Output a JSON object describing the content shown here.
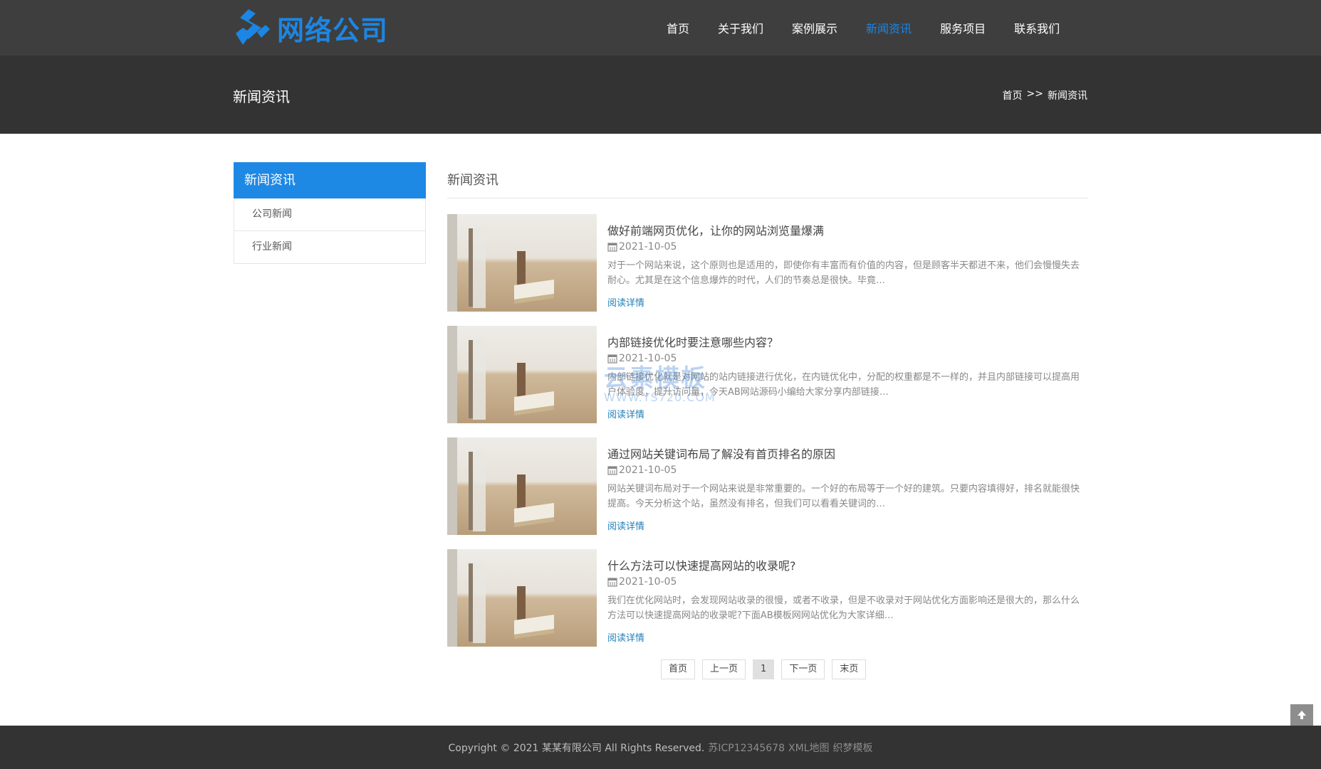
{
  "header": {
    "logo_text": "网络公司",
    "brand_color": "#1c86e4",
    "nav": [
      "首页",
      "关于我们",
      "案例展示",
      "新闻资讯",
      "服务项目",
      "联系我们"
    ],
    "active_nav": "新闻资讯"
  },
  "banner": {
    "title": "新闻资讯",
    "breadcrumb": [
      "首页",
      ">>",
      "新闻资讯"
    ]
  },
  "sidebar": {
    "heading": "新闻资讯",
    "items": [
      "公司新闻",
      "行业新闻"
    ]
  },
  "main": {
    "title": "新闻资讯",
    "articles": [
      {
        "title": "做好前端网页优化，让你的网站浏览量爆满",
        "date": "2021-10-05",
        "desc": "对于一个网站来说，这个原则也是适用的，即使你有丰富而有价值的内容，但是顾客半天都进不来，他们会慢慢失去耐心。尤其是在这个信息爆炸的时代，人们的节奏总是很快。毕竟…",
        "more": "阅读详情"
      },
      {
        "title": "内部链接优化时要注意哪些内容？",
        "date": "2021-10-05",
        "desc": "内部链接优化就是对网站的站内链接进行优化，在内链优化中，分配的权重都是不一样的，并且内部链接可以提高用户体验度，提升访问量，今天AB网站源码小编给大家分享内部链接…",
        "more": "阅读详情"
      },
      {
        "title": "通过网站关键词布局了解没有首页排名的原因",
        "date": "2021-10-05",
        "desc": "网站关键词布局对于一个网站来说是非常重要的。一个好的布局等于一个好的建筑。只要内容填得好，排名就能很快提高。今天分析这个站，虽然没有排名，但我们可以看看关键词的…",
        "more": "阅读详情"
      },
      {
        "title": "什么方法可以快速提高网站的收录呢?",
        "date": "2021-10-05",
        "desc": "我们在优化网站时，会发现网站收录的很慢，或者不收录，但是不收录对于网站优化方面影响还是很大的，那么什么方法可以快速提高网站的收录呢?下面AB模板网网站优化为大家详细…",
        "more": "阅读详情"
      }
    ]
  },
  "pagination": [
    "首页",
    "上一页",
    "1",
    "下一页",
    "末页"
  ],
  "pagination_current": "1",
  "watermark": {
    "cn": "云素模板",
    "en": "WWW.YS720.COM"
  },
  "footer": {
    "copyright": "Copyright © 2021 某某有限公司 All Rights Reserved.",
    "icp": "苏ICP12345678",
    "xml": "XML地图",
    "template": "织梦模板"
  }
}
